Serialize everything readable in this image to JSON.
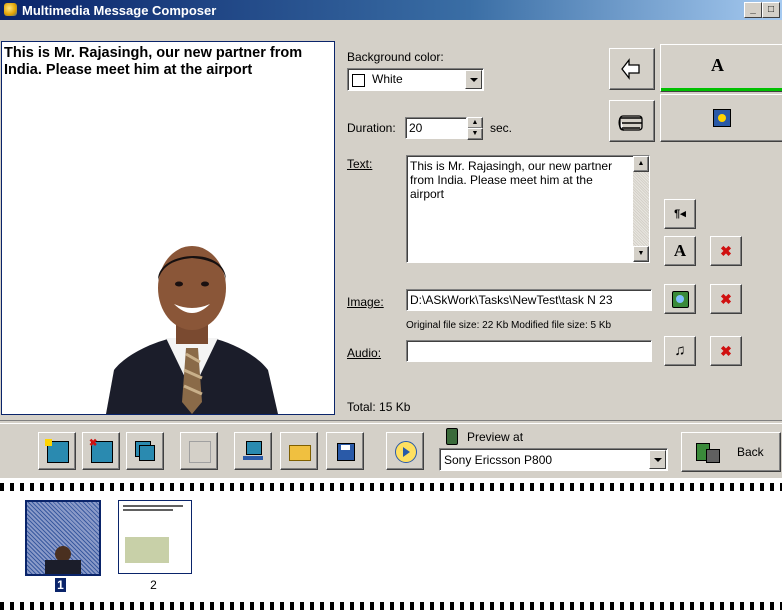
{
  "window": {
    "title": "Multimedia Message Composer",
    "min_label": "_",
    "max_label": "□",
    "close_label": "×"
  },
  "preview": {
    "text": "This is Mr. Rajasingh, our new partner from India. Please meet him at the airport"
  },
  "form": {
    "bg_label": "Background color:",
    "bg_value": "White",
    "duration_label": "Duration:",
    "duration_value": "20",
    "duration_unit": "sec.",
    "text_label": "Text:",
    "text_value": "This is Mr. Rajasingh, our new partner from India. Please meet him at the airport",
    "image_label": "Image:",
    "image_value": "D:\\ASkWork\\Tasks\\NewTest\\task N 23",
    "file_sizes": "Original file size: 22 Kb  Modified file size: 5 Kb",
    "audio_label": "Audio:",
    "audio_value": "",
    "total": "Total: 15 Kb"
  },
  "right_panel": {
    "text_mode_label": "A",
    "accent_color": "#00c000"
  },
  "toolbar": {
    "preview_label": "Preview at",
    "device_value": "Sony Ericsson P800",
    "back_label": "Back"
  },
  "slides": [
    {
      "number": "1"
    },
    {
      "number": "2"
    }
  ],
  "colors": {
    "titlebar": "#0a246a",
    "face": "#d4d0c8",
    "selection": "#0a246a"
  }
}
